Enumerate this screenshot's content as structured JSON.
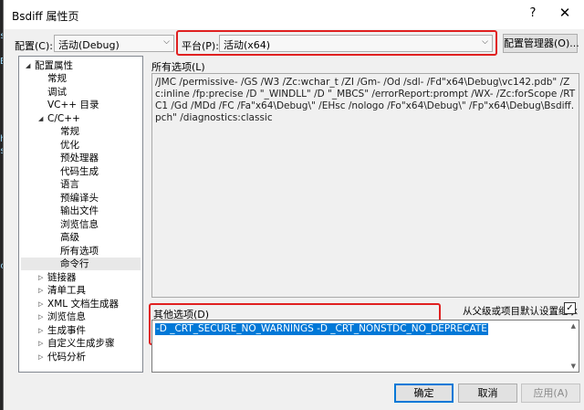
{
  "window": {
    "title": "Bsdiff 属性页",
    "help": "?",
    "close": "✕"
  },
  "config": {
    "label": "配置(C):",
    "value": "活动(Debug)"
  },
  "platform": {
    "label": "平台(P):",
    "value": "活动(x64)"
  },
  "config_manager_button": "配置管理器(O)...",
  "tree": {
    "root": "配置属性",
    "general": "常规",
    "debugging": "调试",
    "vc_dirs": "VC++ 目录",
    "cpp": "C/C++",
    "cpp_children": [
      "常规",
      "优化",
      "预处理器",
      "代码生成",
      "语言",
      "预编译头",
      "输出文件",
      "浏览信息",
      "高级",
      "所有选项",
      "命令行"
    ],
    "others": [
      "链接器",
      "清单工具",
      "XML 文档生成器",
      "浏览信息",
      "生成事件",
      "自定义生成步骤",
      "代码分析"
    ]
  },
  "all_options": {
    "label": "所有选项(L)",
    "text": "/JMC /permissive- /GS /W3 /Zc:wchar_t /ZI /Gm- /Od /sdl- /Fd\"x64\\Debug\\vc142.pdb\" /Zc:inline /fp:precise /D \"_WINDLL\" /D \"_MBCS\" /errorReport:prompt /WX- /Zc:forScope /RTC1 /Gd /MDd /FC /Fa\"x64\\Debug\\\" /EHsc /nologo /Fo\"x64\\Debug\\\" /Fp\"x64\\Debug\\Bsdiff.pch\" /diagnostics:classic"
  },
  "other_options": {
    "label": "其他选项(D)",
    "text": "-D _CRT_SECURE_NO_WARNINGS -D _CRT_NONSTDC_NO_DEPRECATE"
  },
  "inherit": {
    "label": "从父级或项目默认设置继承",
    "checked": true,
    "mark": "✓"
  },
  "buttons": {
    "ok": "确定",
    "cancel": "取消",
    "apply": "应用(A)"
  },
  "background_chars": [
    "s",
    "E",
    "h",
    "s",
    "c"
  ]
}
